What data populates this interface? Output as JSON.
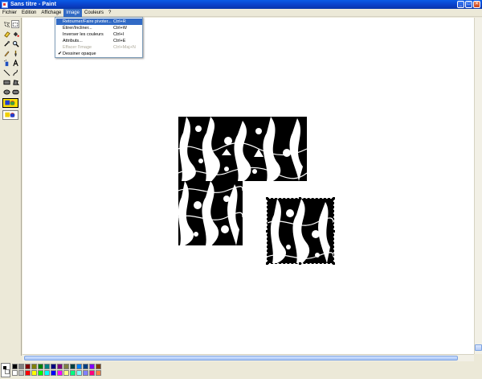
{
  "window": {
    "title": "Sans titre - Paint",
    "minimize": "_",
    "maximize": "□",
    "close": "✕"
  },
  "menu": [
    "Fichier",
    "Edition",
    "Affichage",
    "Image",
    "Couleurs",
    "?"
  ],
  "image_menu": [
    {
      "label": "Retourner/Faire pivoter...",
      "shortcut": "Ctrl+R",
      "state": "highlighted"
    },
    {
      "label": "Étirer/Incliner...",
      "shortcut": "Ctrl+W",
      "state": "normal"
    },
    {
      "label": "Inverser les couleurs",
      "shortcut": "Ctrl+I",
      "state": "normal"
    },
    {
      "label": "Attributs...",
      "shortcut": "Ctrl+E",
      "state": "normal"
    },
    {
      "label": "Effacer l'image",
      "shortcut": "Ctrl+Maj+N",
      "state": "disabled"
    },
    {
      "label": "Dessiner opaque",
      "shortcut": "",
      "state": "checked"
    }
  ],
  "tools": [
    "free-select-icon",
    "rect-select-icon",
    "eraser-icon",
    "fill-icon",
    "picker-icon",
    "magnifier-icon",
    "pencil-icon",
    "brush-icon",
    "airbrush-icon",
    "text-icon",
    "line-icon",
    "curve-icon",
    "rectangle-icon",
    "polygon-icon",
    "ellipse-icon",
    "rounded-rect-icon"
  ],
  "colors": {
    "accent": "#316ac5",
    "palette_top": [
      "#000000",
      "#808080",
      "#800000",
      "#808000",
      "#008000",
      "#008080",
      "#000080",
      "#800080",
      "#808040",
      "#004040",
      "#0080ff",
      "#004080",
      "#8000ff",
      "#804000"
    ],
    "palette_bottom": [
      "#ffffff",
      "#c0c0c0",
      "#ff0000",
      "#ffff00",
      "#00ff00",
      "#00ffff",
      "#0000ff",
      "#ff00ff",
      "#ffff80",
      "#00ff80",
      "#80ffff",
      "#8080ff",
      "#ff0080",
      "#ff8040"
    ]
  }
}
